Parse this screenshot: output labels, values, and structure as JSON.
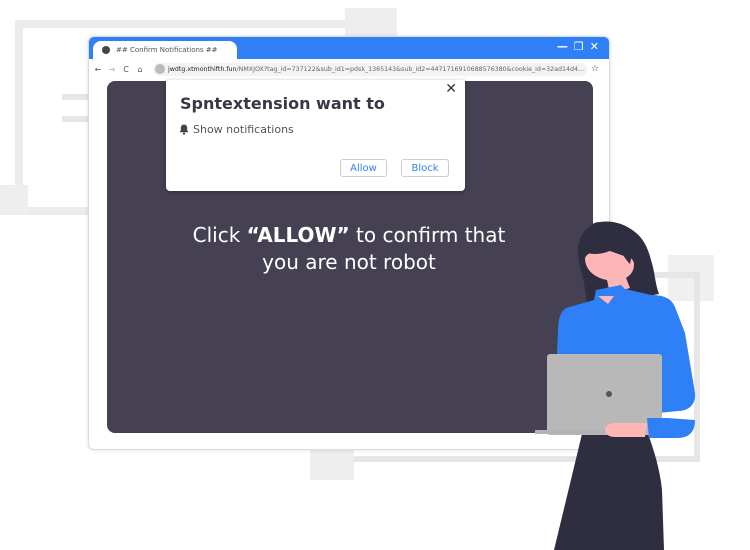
{
  "browser": {
    "tab_title": "## Confirm Notifications ##",
    "url_domain": "jwdtg.xtmonthifth.fun",
    "url_path": "/NMXJOX?tag_id=737122&sub_id1=pdsk_1365143&sub_id2=4471716910688576380&cookie_id=32ad14d4...",
    "window_controls": {
      "minimize": "—",
      "restore": "❐",
      "close": "✕"
    },
    "nav": {
      "back": "←",
      "forward": "→",
      "reload": "C",
      "home": "⌂",
      "bookmark": "☆"
    }
  },
  "popup": {
    "title": "Spntextension want to",
    "permission": "Show notifications",
    "permission_icon": "bell-icon",
    "close": "✕",
    "allow_label": "Allow",
    "block_label": "Block"
  },
  "message": {
    "prefix": "Click ",
    "highlight": "“ALLOW”",
    "suffix": " to confirm that",
    "line2": "you  are not robot"
  },
  "colors": {
    "accent": "#2f7ff7",
    "panel": "#454152",
    "figure_dark": "#2f2e41",
    "skin": "#ffb6b6",
    "laptop": "#b8b8b8"
  }
}
